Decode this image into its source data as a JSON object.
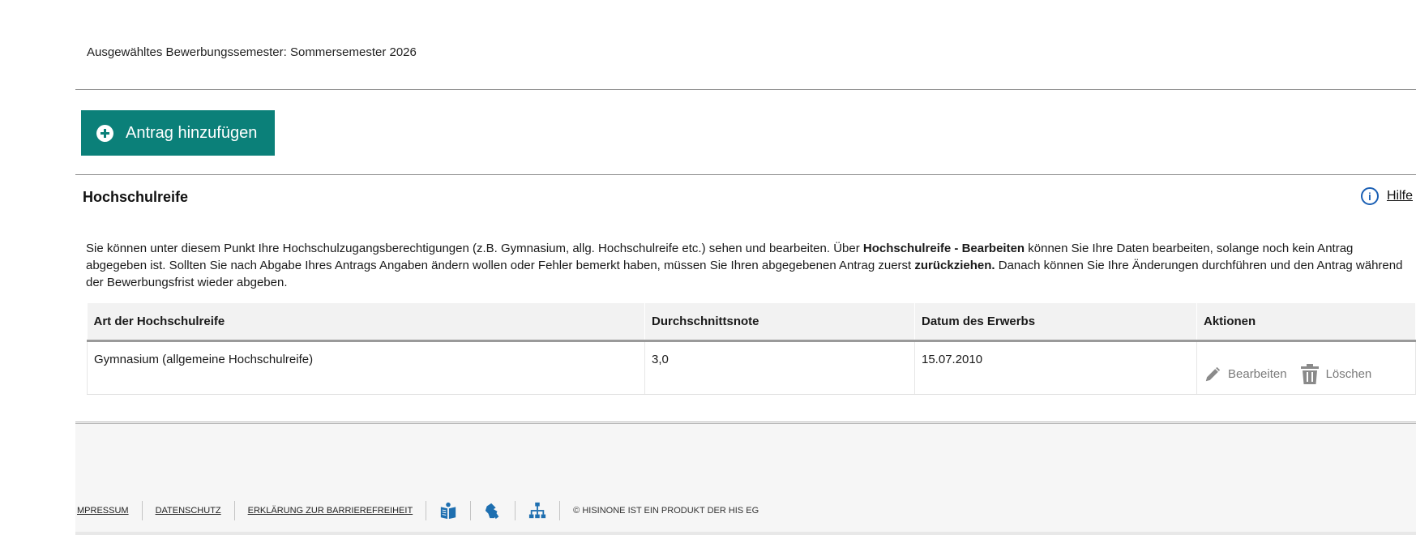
{
  "semester": {
    "label": "Ausgewähltes Bewerbungssemester:",
    "value": "Sommersemester 2026"
  },
  "add_button": {
    "label": "Antrag hinzufügen",
    "icon": "plus-circle-icon"
  },
  "section": {
    "title": "Hochschulreife",
    "help_label": "Hilfe",
    "help_icon": "info-circle-icon"
  },
  "description": {
    "part1": "Sie können unter diesem Punkt Ihre Hochschulzugangsberechtigungen (z.B. Gymnasium, allg. Hochschulreife etc.) sehen und bearbeiten. Über ",
    "bold1": "Hochschulreife - Bearbeiten",
    "part2": " können Sie Ihre Daten bearbeiten, solange noch kein Antrag abgegeben ist. Sollten Sie nach Abgabe Ihres Antrags Angaben ändern wollen oder Fehler bemerkt haben, müssen Sie Ihren abgegebenen Antrag zuerst ",
    "bold2": "zurückziehen.",
    "part3": " Danach können Sie Ihre Änderungen durchführen und den Antrag während der Bewerbungsfrist wieder abgeben."
  },
  "table": {
    "headers": [
      "Art der Hochschulreife",
      "Durchschnittsnote",
      "Datum des Erwerbs",
      "Aktionen"
    ],
    "rows": [
      {
        "art": "Gymnasium (allgemeine Hochschulreife)",
        "note": "3,0",
        "datum": "15.07.2010",
        "edit_label": "Bearbeiten",
        "delete_label": "Löschen"
      }
    ]
  },
  "footer": {
    "links": [
      "MPRESSUM",
      "DATENSCHUTZ",
      "ERKLÄRUNG ZUR BARRIEREFREIHEIT"
    ],
    "icons": [
      "easy-language-book-icon",
      "sign-language-icon",
      "sitemap-icon"
    ],
    "copyright": "© HISINONE IST EIN PRODUKT DER HIS EG"
  },
  "colors": {
    "primary": "#0b8079",
    "info": "#1a5fb4"
  }
}
